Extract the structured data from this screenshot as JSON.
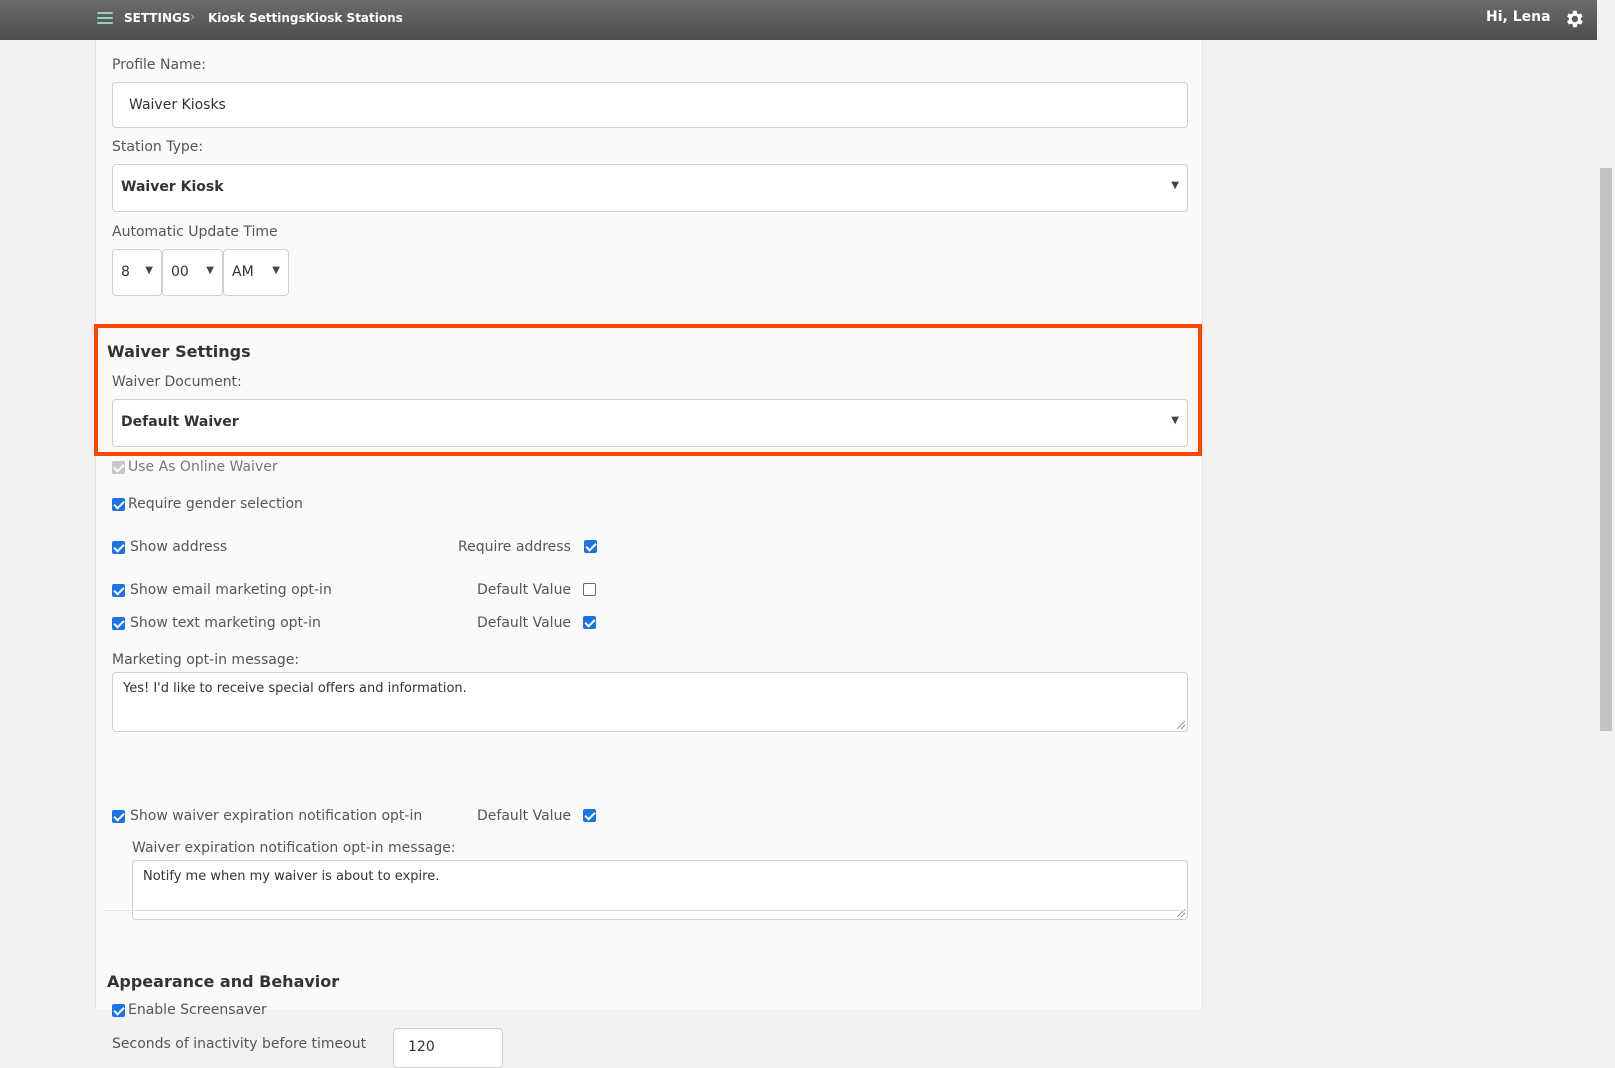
{
  "topbar": {
    "breadcrumb_root": "SETTINGS",
    "breadcrumb_separator": "›",
    "breadcrumb_leaf": "Kiosk SettingsKiosk Stations",
    "greeting": "Hi, Lena"
  },
  "form": {
    "profile_name_label": "Profile Name:",
    "profile_name_value": "Waiver Kiosks",
    "station_type_label": "Station Type:",
    "station_type_value": "Waiver Kiosk",
    "update_time_label": "Automatic Update Time",
    "update_hour": "8",
    "update_minute": "00",
    "update_ampm": "AM"
  },
  "waiver": {
    "section_title": "Waiver Settings",
    "document_label": "Waiver Document:",
    "document_value": "Default Waiver",
    "online_waiver_label": "Use As Online Waiver",
    "require_gender_label": "Require gender selection",
    "show_address_label": "Show address",
    "require_address_label": "Require address",
    "show_email_label": "Show email marketing opt-in",
    "email_default_label": "Default Value",
    "show_text_label": "Show text marketing opt-in",
    "text_default_label": "Default Value",
    "marketing_message_label": "Marketing opt-in message:",
    "marketing_message_value": "Yes! I'd like to receive special offers and information.",
    "show_expiration_label": "Show waiver expiration notification opt-in",
    "expiration_default_label": "Default Value",
    "expiration_message_label": "Waiver expiration notification opt-in message:",
    "expiration_message_value": "Notify me when my waiver is about to expire."
  },
  "appearance": {
    "section_title": "Appearance and Behavior",
    "screensaver_label": "Enable Screensaver",
    "timeout_label": "Seconds of inactivity before timeout",
    "timeout_value": "120"
  },
  "checkbox_states": {
    "use_as_online_waiver": true,
    "require_gender": true,
    "show_address": true,
    "require_address": true,
    "show_email_optin": true,
    "email_default": false,
    "show_text_optin": true,
    "text_default": true,
    "show_expiration_optin": true,
    "expiration_default": true,
    "enable_screensaver": true
  },
  "colors": {
    "topbar": "#555555",
    "accent_check": "#1a73e8",
    "highlight": "#ff4500",
    "menu_icon": "#8fd3b8"
  }
}
